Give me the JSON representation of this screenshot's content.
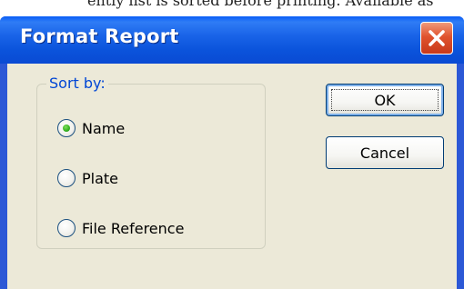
{
  "background_text": "ently list is sorted before printing. Available as",
  "window": {
    "title": "Format Report",
    "close_icon": "close-icon",
    "colors": {
      "titlebar": "#0a54dc",
      "client": "#ece9d8",
      "close_button": "#e0532e",
      "group_label": "#0046d5"
    }
  },
  "sort_group": {
    "label": "Sort by:",
    "options": [
      {
        "label": "Name",
        "selected": true
      },
      {
        "label": "Plate",
        "selected": false
      },
      {
        "label": "File Reference",
        "selected": false
      }
    ]
  },
  "buttons": {
    "ok": "OK",
    "cancel": "Cancel"
  }
}
